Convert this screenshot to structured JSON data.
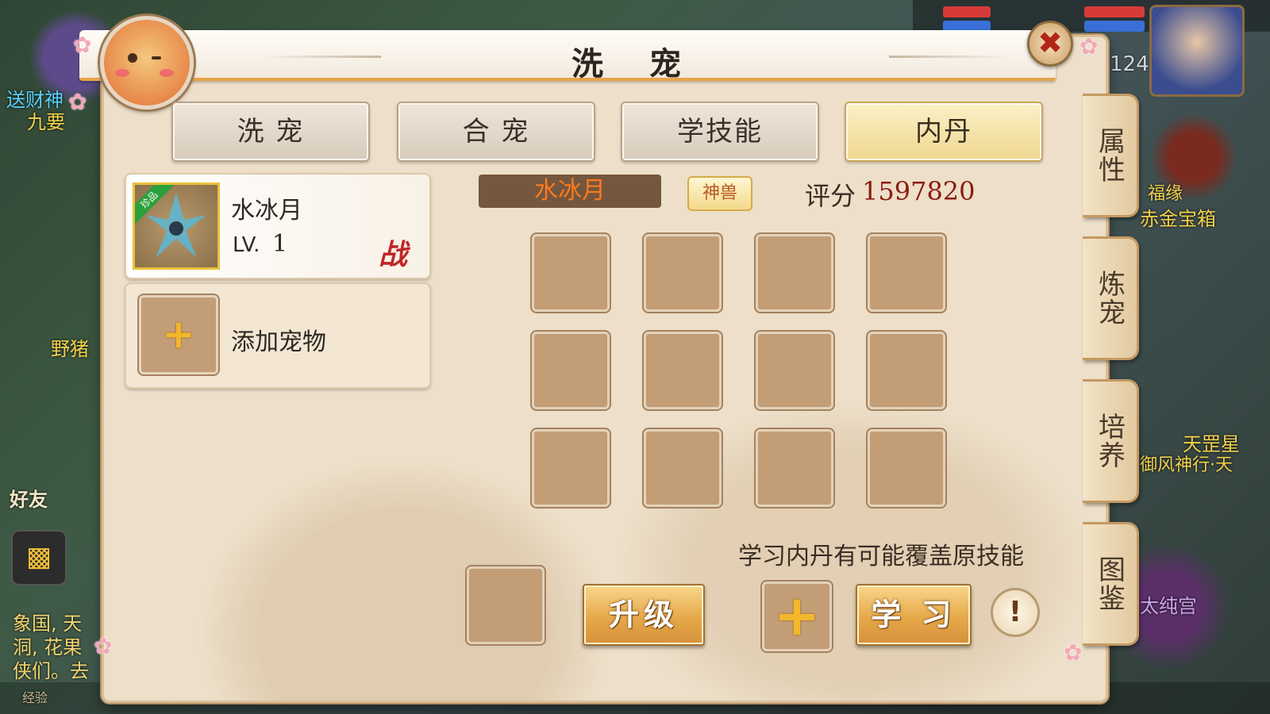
{
  "window": {
    "title": "洗 宠"
  },
  "tabs": [
    {
      "label": "洗  宠",
      "active": false
    },
    {
      "label": "合  宠",
      "active": false
    },
    {
      "label": "学技能",
      "active": false
    },
    {
      "label": "内丹",
      "active": true
    }
  ],
  "side_tabs": [
    "属性",
    "炼宠",
    "培养",
    "图鉴"
  ],
  "pet": {
    "quality": "珍品",
    "name": "水冰月",
    "level_label": "LV.",
    "level": "1",
    "battle_mark": "战"
  },
  "add_pet": {
    "icon": "+",
    "label": "添加宠物"
  },
  "info": {
    "pet_name": "水冰月",
    "badge": "神兽",
    "score_label": "评分",
    "score": "1597820"
  },
  "skill_slots": {
    "rows": 3,
    "cols": 4
  },
  "hint": "学习内丹有可能覆盖原技能",
  "actions": {
    "upgrade": "升级",
    "add": "+",
    "learn": "学 习",
    "info": "!"
  },
  "background": {
    "texts": [
      "送财神",
      "九要",
      "野猪",
      "好友",
      "福缘",
      "赤金宝箱",
      "天罡星",
      "御风神行·天",
      "太纯宫",
      "象国, 天",
      "洞, 花果",
      "侠们。去",
      "经验"
    ],
    "hud_level": "124"
  },
  "colors": {
    "panel_bg": "#eddfc9",
    "accent_gold": "#e6a94a",
    "score_red": "#8b1a10",
    "name_orange": "#ff7a1e",
    "slot_brown": "#c29d76"
  }
}
